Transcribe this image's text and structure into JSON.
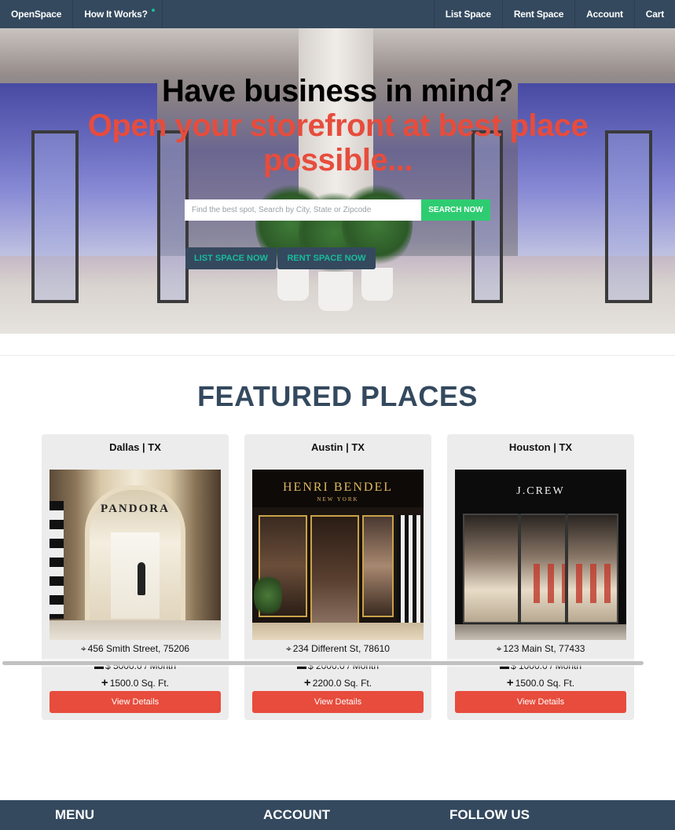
{
  "navbar": {
    "brand": "OpenSpace",
    "how_it_works": "How It Works?",
    "right": [
      "List Space",
      "Rent Space",
      "Account",
      "Cart"
    ]
  },
  "hero": {
    "title": "Have business in mind?",
    "subtitle": "Open your storefront at best place possible...",
    "search_placeholder": "Find the best spot, Search by City, State or Zipcode",
    "search_button": "SEARCH NOW",
    "list_button": "LIST SPACE NOW",
    "rent_button": "RENT SPACE NOW"
  },
  "featured": {
    "title": "FEATURED PLACES",
    "cards": [
      {
        "city": "Dallas | TX",
        "address": "456 Smith Street, 75206",
        "price": "$ 5000.0 / Month",
        "sqft": "1500.0 Sq. Ft.",
        "button": "View Details",
        "sign": "PANDORA"
      },
      {
        "city": "Austin | TX",
        "address": "234 Different St, 78610",
        "price": "$ 2000.0 / Month",
        "sqft": "2200.0 Sq. Ft.",
        "button": "View Details",
        "sign": "HENRI BENDEL",
        "sign_sub": "NEW YORK"
      },
      {
        "city": "Houston | TX",
        "address": "123 Main St, 77433",
        "price": "$ 1000.0 / Month",
        "sqft": "1500.0 Sq. Ft.",
        "button": "View Details",
        "sign": "J.CREW"
      }
    ]
  },
  "footer": {
    "menu": "MENU",
    "account": "ACCOUNT",
    "follow": "FOLLOW US"
  },
  "colors": {
    "navy": "#34495e",
    "accent_red": "#e74c3c",
    "accent_green": "#2ecc71",
    "accent_teal": "#1abc9c"
  }
}
